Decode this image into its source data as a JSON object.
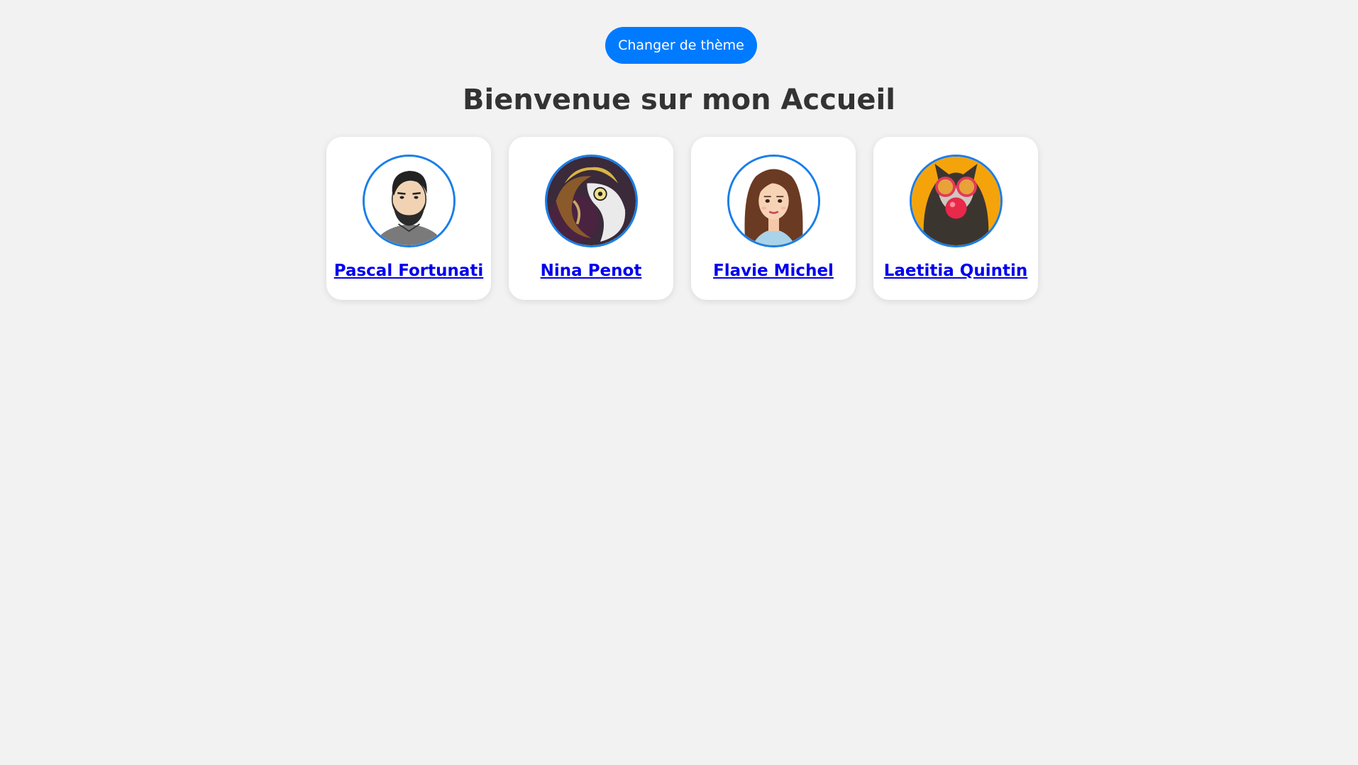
{
  "theme_button": {
    "label": "Changer de thème"
  },
  "heading": "Bienvenue sur mon Accueil",
  "colors": {
    "background": "#f2f2f2",
    "accent": "#007bff",
    "link": "#0000ee",
    "avatar_border": "#1a7ee8"
  },
  "profiles": [
    {
      "name": "Pascal Fortunati",
      "avatar": "bearded-man-cartoon"
    },
    {
      "name": "Nina Penot",
      "avatar": "mythical-creature-art"
    },
    {
      "name": "Flavie Michel",
      "avatar": "woman-illustration"
    },
    {
      "name": "Laetitia Quintin",
      "avatar": "raccoon-with-glasses"
    }
  ]
}
